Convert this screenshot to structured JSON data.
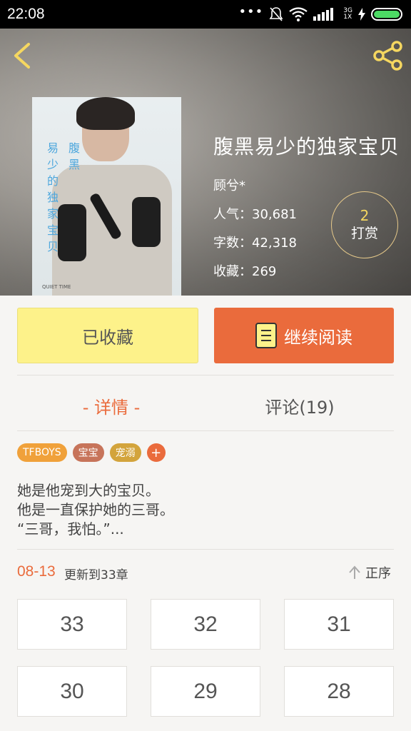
{
  "status_bar": {
    "time": "22:08",
    "network": [
      "3G",
      "1X"
    ],
    "battery_color": "#4cd964"
  },
  "book": {
    "title": "腹黑易少的独家宝贝",
    "author": "顾兮*",
    "popularity": "人气：30,681",
    "word_count": "字数：42,318",
    "favorites": "收藏：269",
    "cover_text": [
      "易",
      "腹",
      "少",
      "黑",
      "的",
      "独",
      "家",
      "宝",
      "贝"
    ],
    "cover_footer": "QUIET TIME"
  },
  "tip": {
    "count": "2",
    "label": "打赏"
  },
  "actions": {
    "collected_label": "已收藏",
    "continue_label": "继续阅读"
  },
  "tabs": [
    {
      "label": "- 详情 -",
      "active": true
    },
    {
      "label": "评论(19)",
      "active": false
    }
  ],
  "tags": [
    {
      "label": "TFBOYS",
      "color": "#f0a13a"
    },
    {
      "label": "宝宝",
      "color": "#c7745a"
    },
    {
      "label": "宠溺",
      "color": "#d3a43c"
    }
  ],
  "tag_more": "+",
  "synopsis": [
    "她是他宠到大的宝贝。",
    "他是一直保护她的三哥。",
    "“三哥，我怕。”..."
  ],
  "update": {
    "date": "08-13",
    "text": "更新到33章",
    "sort_label": "正序"
  },
  "chapters": [
    "33",
    "32",
    "31",
    "30",
    "29",
    "28"
  ],
  "colors": {
    "accent": "#ea6b3c",
    "collected_bg": "#fdf28a",
    "tip_count": "#f5d760"
  }
}
